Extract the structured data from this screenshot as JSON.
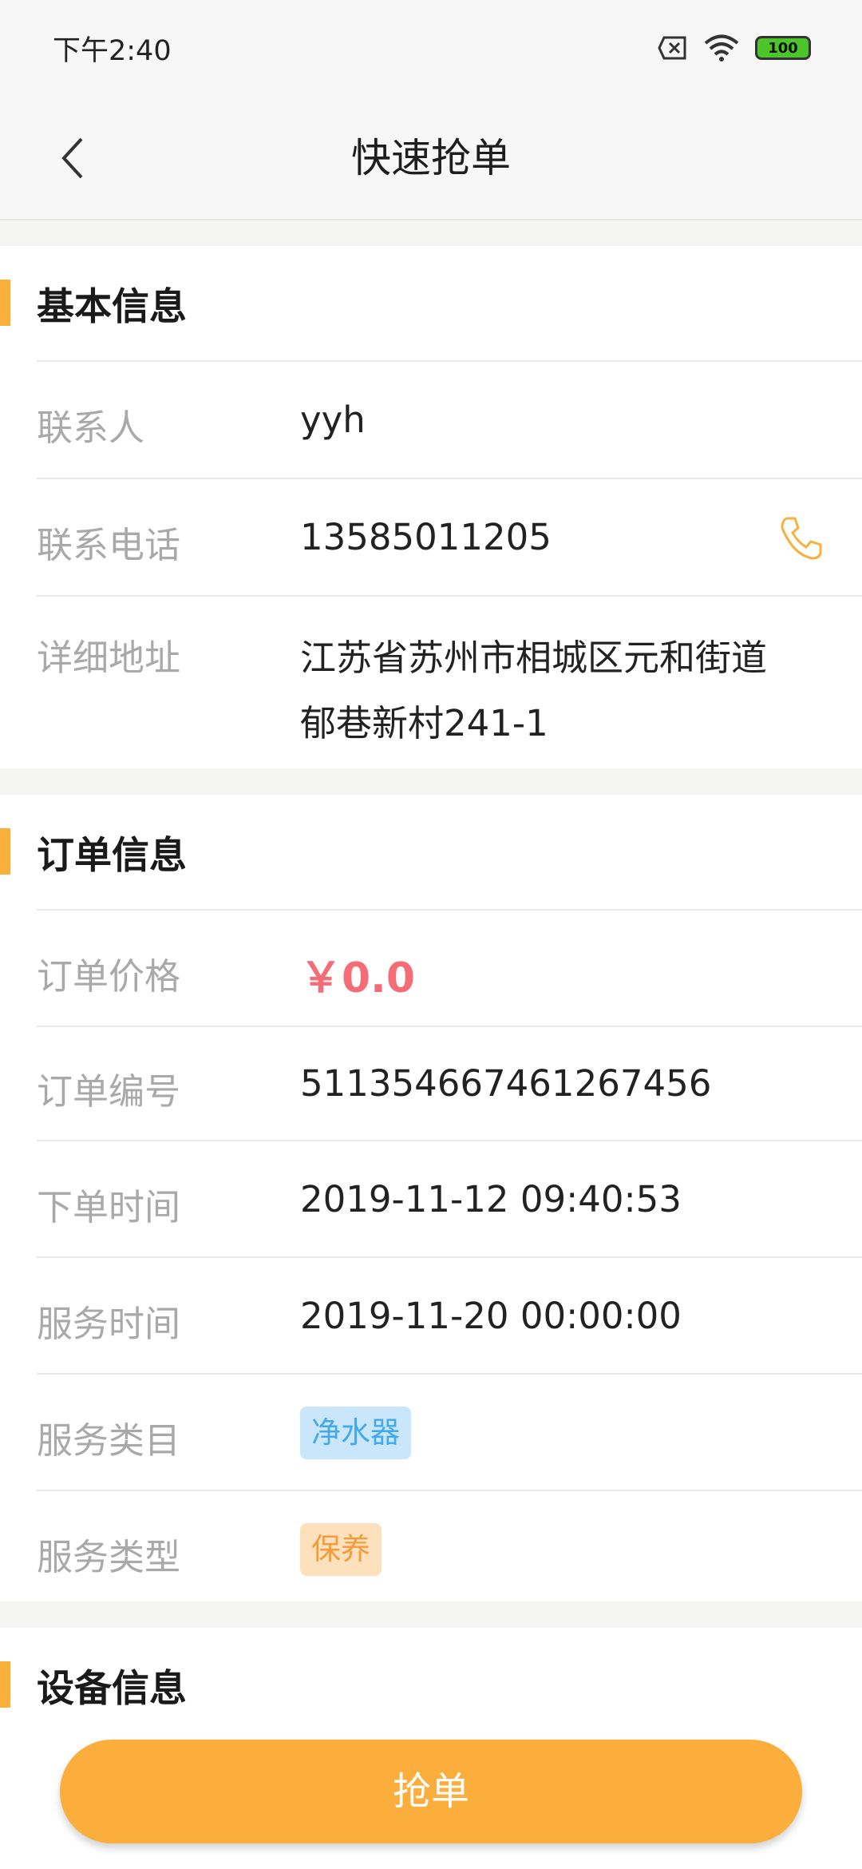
{
  "status_bar": {
    "time": "下午2:40",
    "battery": "100"
  },
  "nav": {
    "title": "快速抢单"
  },
  "basic_info": {
    "title": "基本信息",
    "contact_label": "联系人",
    "contact_value": "yyh",
    "phone_label": "联系电话",
    "phone_value": "13585011205",
    "address_label": "详细地址",
    "address_line1": "江苏省苏州市相城区元和街道",
    "address_line2": "郁巷新村241-1"
  },
  "order_info": {
    "title": "订单信息",
    "price_label": "订单价格",
    "price_value": "￥0.0",
    "number_label": "订单编号",
    "number_value": "511354667461267456",
    "order_time_label": "下单时间",
    "order_time_value": "2019-11-12 09:40:53",
    "service_time_label": "服务时间",
    "service_time_value": "2019-11-20 00:00:00",
    "category_label": "服务类目",
    "category_tag": "净水器",
    "type_label": "服务类型",
    "type_tag": "保养"
  },
  "device_info": {
    "title": "设备信息"
  },
  "actions": {
    "grab_label": "抢单"
  },
  "colors": {
    "accent": "#fbb03b",
    "price": "#f46c75",
    "button": "#fbae3c"
  }
}
